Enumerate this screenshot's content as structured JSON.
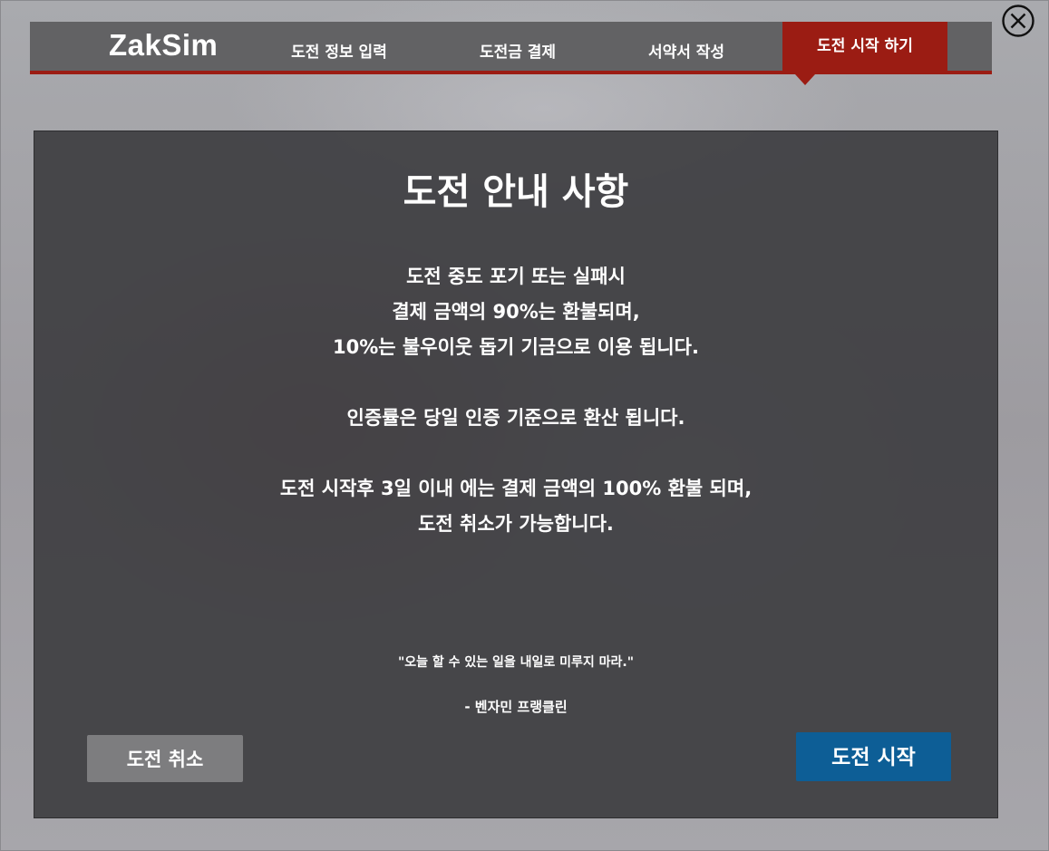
{
  "brand": {
    "logo": "ZakSim"
  },
  "nav": {
    "tabs": [
      {
        "label": "도전 정보 입력"
      },
      {
        "label": "도전금 결제"
      },
      {
        "label": "서약서 작성"
      },
      {
        "label": "도전 시작 하기"
      }
    ],
    "active_tab_index": 3,
    "accent_color": "#9b1c13"
  },
  "close_icon": "close-circle-x-icon",
  "notice": {
    "title": "도전 안내 사항",
    "paragraph_1": [
      "도전 중도 포기 또는 실패시",
      "결제 금액의 90%는 환불되며,",
      "10%는 불우이웃 돕기 기금으로 이용 됩니다."
    ],
    "paragraph_2": [
      "인증률은 당일 인증 기준으로 환산 됩니다."
    ],
    "paragraph_3": [
      "도전 시작후 3일 이내 에는 결제 금액의 100% 환불 되며,",
      "도전 취소가 가능합니다."
    ],
    "quote": "\"오늘 할 수 있는 일을 내일로 미루지 마라.\"",
    "quote_author": "- 벤자민 프랭클린"
  },
  "actions": {
    "cancel_label": "도전 취소",
    "cancel_color": "#7d7d7f",
    "start_label": "도전 시작",
    "start_color": "#0d5e96"
  }
}
